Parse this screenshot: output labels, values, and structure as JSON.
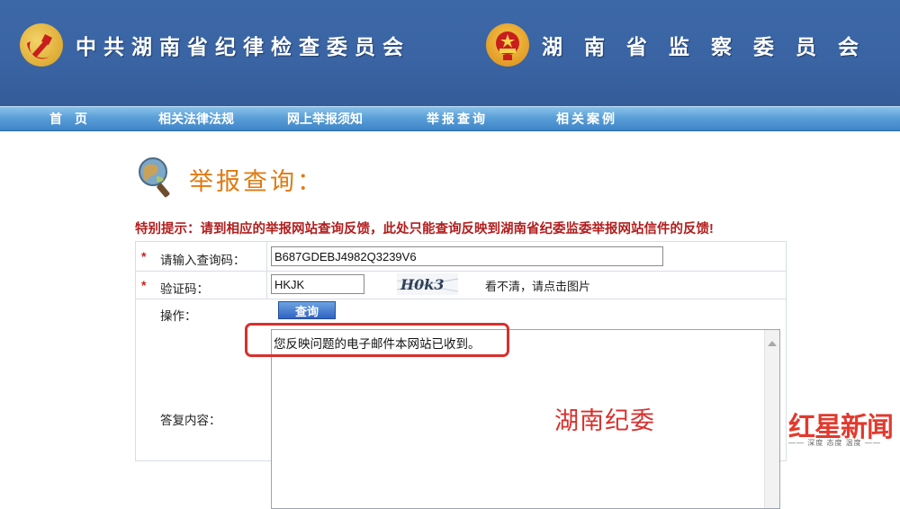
{
  "header": {
    "left_org": "中共湖南省纪律检查委员会",
    "right_org": "湖南省监察委员会",
    "left_emblem_icon": "party-emblem-icon",
    "right_emblem_icon": "national-emblem-icon"
  },
  "nav": {
    "items": [
      {
        "label": "首　页"
      },
      {
        "label": "相关法律法规"
      },
      {
        "label": "网上举报须知"
      },
      {
        "label": "举报查询"
      },
      {
        "label": "相关案例"
      }
    ]
  },
  "page": {
    "title": "举报查询：",
    "title_icon": "magnifier-globe-icon",
    "notice": "特别提示：请到相应的举报网站查询反馈，此处只能查询反映到湖南省纪委监委举报网站信件的反馈!"
  },
  "form": {
    "required_mark": "*",
    "query_code_label": "请输入查询码：",
    "query_code_value": "B687GDEBJ4982Q3239V6",
    "captcha_label": "验证码：",
    "captcha_value": "HKJK",
    "captcha_image_text": "H0k3",
    "captcha_hint": "看不清，请点击图片",
    "action_label": "操作：",
    "query_button": "查询",
    "reply_label": "答复内容：",
    "reply_text": "您反映问题的电子邮件本网站已收到。"
  },
  "annotation": {
    "overlay_text": "湖南纪委",
    "highlight_color": "#d8302d"
  },
  "watermark": {
    "brand": "红星新闻",
    "tagline": "—— 深度 态度 温度 ——"
  },
  "colors": {
    "banner": "#3a64a3",
    "title_orange": "#e07a12",
    "notice_red": "#b21e1e"
  }
}
